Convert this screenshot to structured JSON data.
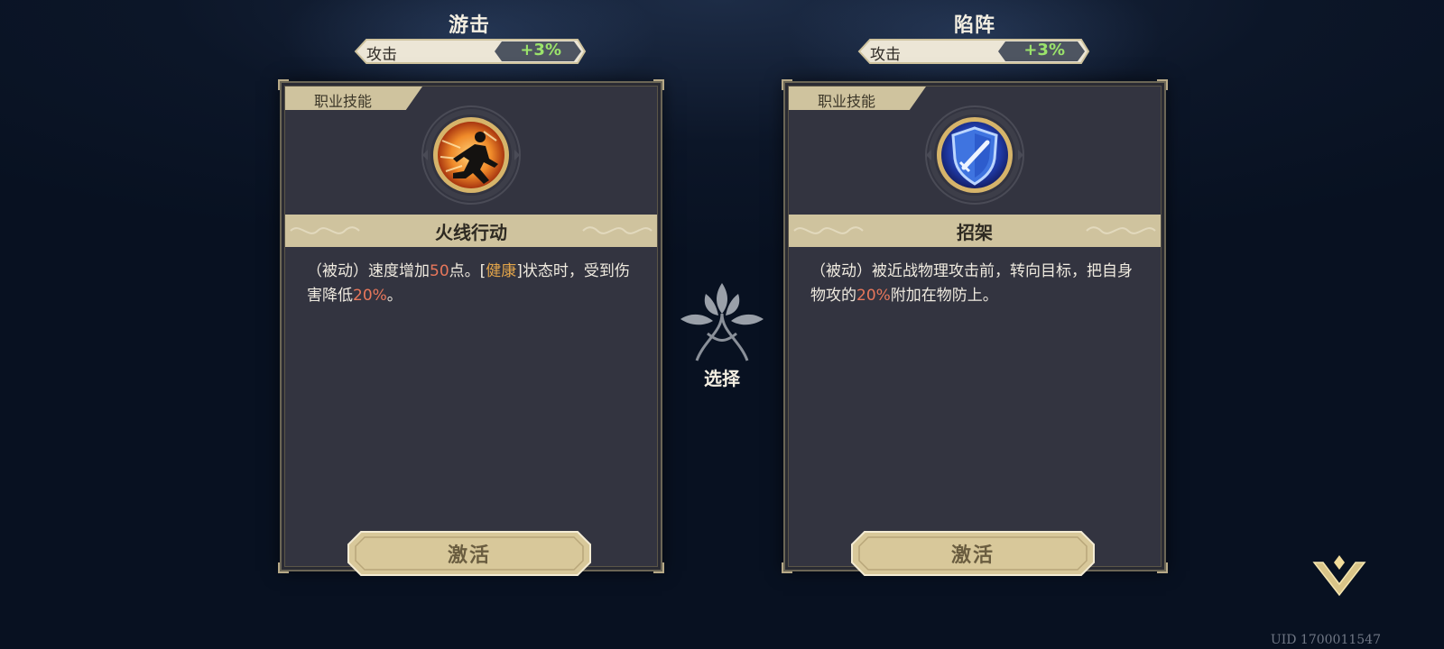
{
  "columns": [
    {
      "class_title": "游击",
      "stat": {
        "label": "攻击",
        "value": "+3%"
      },
      "card": {
        "category": "职业技能",
        "icon": "running-figure-fire-icon",
        "skill_name": "火线行动",
        "desc": {
          "p1": "（被动）速度增加",
          "n1": "50",
          "p2": "点。[",
          "tag": "健康",
          "p3": "]状态时，受到伤害降低",
          "n2": "20%",
          "p4": "。"
        },
        "button": "激活"
      }
    },
    {
      "class_title": "陷阵",
      "stat": {
        "label": "攻击",
        "value": "+3%"
      },
      "card": {
        "category": "职业技能",
        "icon": "shield-sword-icon",
        "skill_name": "招架",
        "desc": {
          "p1": "（被动）被近战物理攻击前，转向目标，把自身物攻的",
          "n1": "20%",
          "p2": "附加在物防上。"
        },
        "button": "激活"
      }
    }
  ],
  "select_label": "选择",
  "uid": "UID 1700011547",
  "colors": {
    "background": "#0c1628",
    "card": "#333440",
    "gold": "#cfc39e",
    "stat_green": "#9be36b",
    "highlight_number": "#e8775b",
    "highlight_tag": "#e2a44a"
  },
  "icons": {
    "center_emblem": "tree-emblem-icon",
    "corner_button": "chevron-down-icon"
  }
}
